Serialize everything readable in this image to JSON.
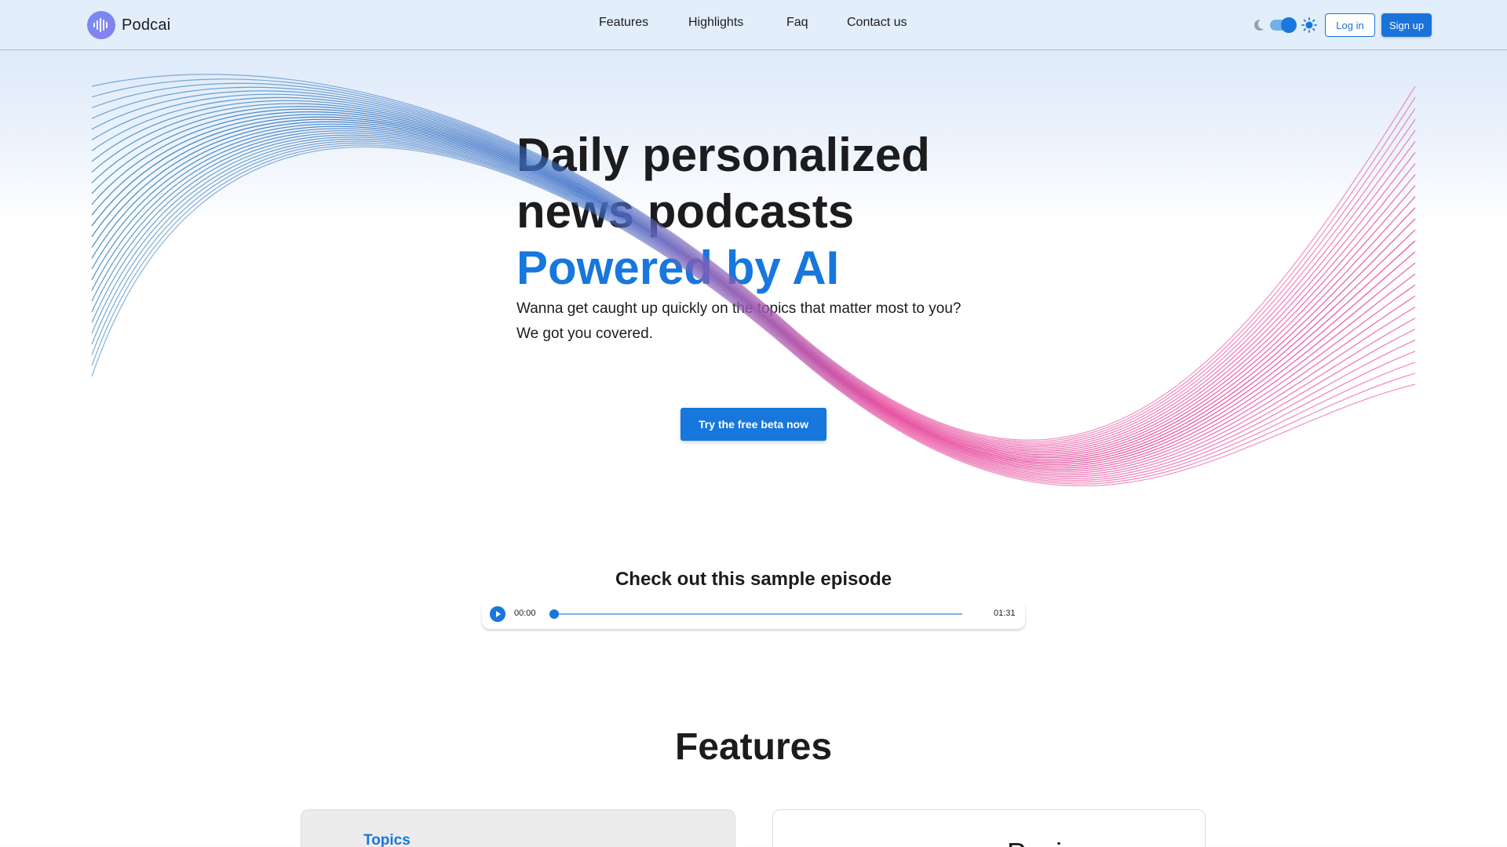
{
  "brand": {
    "name": "Podcai",
    "logo_icon": "soundwave-icon",
    "accent_color": "#1777dd"
  },
  "nav": {
    "items": [
      {
        "label": "Features"
      },
      {
        "label": "Highlights"
      },
      {
        "label": "Faq"
      },
      {
        "label": "Contact us"
      }
    ]
  },
  "header_actions": {
    "theme_toggle": {
      "dark_icon": "moon-icon",
      "light_icon": "sun-icon",
      "state": "light"
    },
    "login_label": "Log in",
    "signup_label": "Sign up"
  },
  "hero": {
    "title_line1": "Daily personalized",
    "title_line2": "news podcasts",
    "title_accent": "Powered by AI",
    "subtitle_line1": "Wanna get caught up quickly on the topics that matter most to you?",
    "subtitle_line2": "We got you covered.",
    "cta_label": "Try the free beta now",
    "wave_colors": [
      "#2c7fb8",
      "#e6449a"
    ]
  },
  "sample": {
    "title": "Check out this sample episode",
    "current_time": "00:00",
    "duration": "01:31",
    "progress": 0,
    "play_icon": "play-icon"
  },
  "features": {
    "title": "Features",
    "cards": [
      {
        "title": "Topics"
      },
      {
        "title": "Pacing"
      }
    ]
  }
}
